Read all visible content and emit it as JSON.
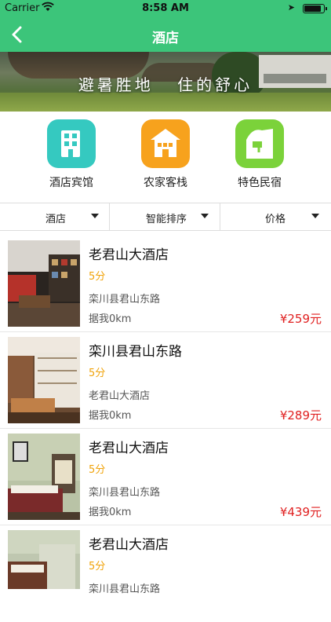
{
  "status_bar": {
    "carrier": "Carrier",
    "time": "8:58 AM"
  },
  "nav": {
    "title": "酒店"
  },
  "banner": {
    "slogan": "避暑胜地 住的舒心"
  },
  "categories": [
    {
      "label": "酒店宾馆",
      "color": "#35c9c0",
      "icon": "hotel-building-icon"
    },
    {
      "label": "农家客栈",
      "color": "#f7a21d",
      "icon": "farmhouse-icon"
    },
    {
      "label": "特色民宿",
      "color": "#7bd23a",
      "icon": "homestay-icon"
    }
  ],
  "filters": [
    {
      "label": "酒店"
    },
    {
      "label": "智能排序"
    },
    {
      "label": "价格"
    }
  ],
  "hotels": [
    {
      "name": "老君山大酒店",
      "score": "5分",
      "address": "栾川县君山东路",
      "distance": "据我0km",
      "price": "¥259元"
    },
    {
      "name": "栾川县君山东路",
      "score": "5分",
      "address": "老君山大酒店",
      "distance": "据我0km",
      "price": "¥289元"
    },
    {
      "name": "老君山大酒店",
      "score": "5分",
      "address": "栾川县君山东路",
      "distance": "据我0km",
      "price": "¥439元"
    },
    {
      "name": "老君山大酒店",
      "score": "5分",
      "address": "栾川县君山东路",
      "distance": "",
      "price": ""
    }
  ],
  "colors": {
    "primary": "#3cc57a",
    "price": "#e02020",
    "score": "#f0a30a"
  }
}
